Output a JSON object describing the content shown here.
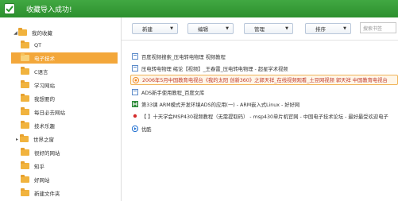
{
  "window": {
    "title": "收藏导入成功!"
  },
  "sidebar": {
    "items": [
      {
        "label": "我的收藏",
        "arrow": "◢",
        "level": 0
      },
      {
        "label": "QT",
        "arrow": "",
        "level": 1
      },
      {
        "label": "电子技术",
        "arrow": "",
        "level": 1,
        "selected": true
      },
      {
        "label": "C语言",
        "arrow": "",
        "level": 1
      },
      {
        "label": "学习网站",
        "arrow": "",
        "level": 1
      },
      {
        "label": "我想要的",
        "arrow": "",
        "level": 1
      },
      {
        "label": "每日必去网站",
        "arrow": "",
        "level": 1
      },
      {
        "label": "技术乐趣",
        "arrow": "",
        "level": 1
      },
      {
        "label": "世界之窗",
        "arrow": "▸",
        "level": 1
      },
      {
        "label": "很好的网站",
        "arrow": "",
        "level": 1
      },
      {
        "label": "知乎",
        "arrow": "",
        "level": 1
      },
      {
        "label": "好网站",
        "arrow": "",
        "level": 1
      },
      {
        "label": "新建文件夹",
        "arrow": "",
        "level": 1
      }
    ]
  },
  "toolbar": {
    "new_label": "新建",
    "edit_label": "编辑",
    "manage_label": "管理",
    "sort_label": "排序",
    "caret": "▼",
    "search_placeholder": "搜索书签"
  },
  "bookmarks": [
    {
      "title": "百度视频搜索_压电转电物理 视频教程",
      "icon": "generic-page-icon"
    },
    {
      "title": "压电转电物理 绪论【视频】_王春雷_压电转电物理 - 超星学术视频",
      "icon": "generic-page-icon"
    },
    {
      "title": "2006年5月中国教育电视台《我的太阳 创新360》之郭天祥_在线视频观看_土豆网视频 郭天祥 中国教育电视台",
      "icon": "tudou-icon",
      "highlight": true
    },
    {
      "title": "ADS新手使用教程_百度文库",
      "icon": "generic-page-icon"
    },
    {
      "title": "第33课 ARM模式开发环境ADS的应用(一) - ARM嵌入式Linux - 好好网",
      "icon": "green-h-icon"
    },
    {
      "title": "【 】十天学会MSP430视频教程（无需提取码） - msp430单片机官网 - 中国电子技术论坛 - 最好最受欢迎电子",
      "icon": "red-dot-icon"
    },
    {
      "title": "优酷",
      "icon": "youku-icon"
    }
  ]
}
